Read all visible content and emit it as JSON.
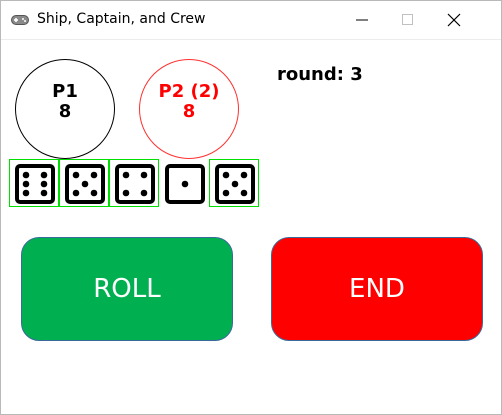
{
  "window": {
    "title": "Ship, Captain, and Crew"
  },
  "players": [
    {
      "name": "P1",
      "score": "8",
      "color": "#000000"
    },
    {
      "name": "P2 (2)",
      "score": "8",
      "color": "#ff0000"
    }
  ],
  "round": {
    "text": "round: 3"
  },
  "dice": [
    {
      "value": 6,
      "selected": true
    },
    {
      "value": 5,
      "selected": true
    },
    {
      "value": 4,
      "selected": true
    },
    {
      "value": 1,
      "selected": false
    },
    {
      "value": 5,
      "selected": true
    }
  ],
  "buttons": {
    "roll": {
      "label": "ROLL",
      "color": "#00b050"
    },
    "end": {
      "label": "END",
      "color": "#ff0000"
    }
  }
}
